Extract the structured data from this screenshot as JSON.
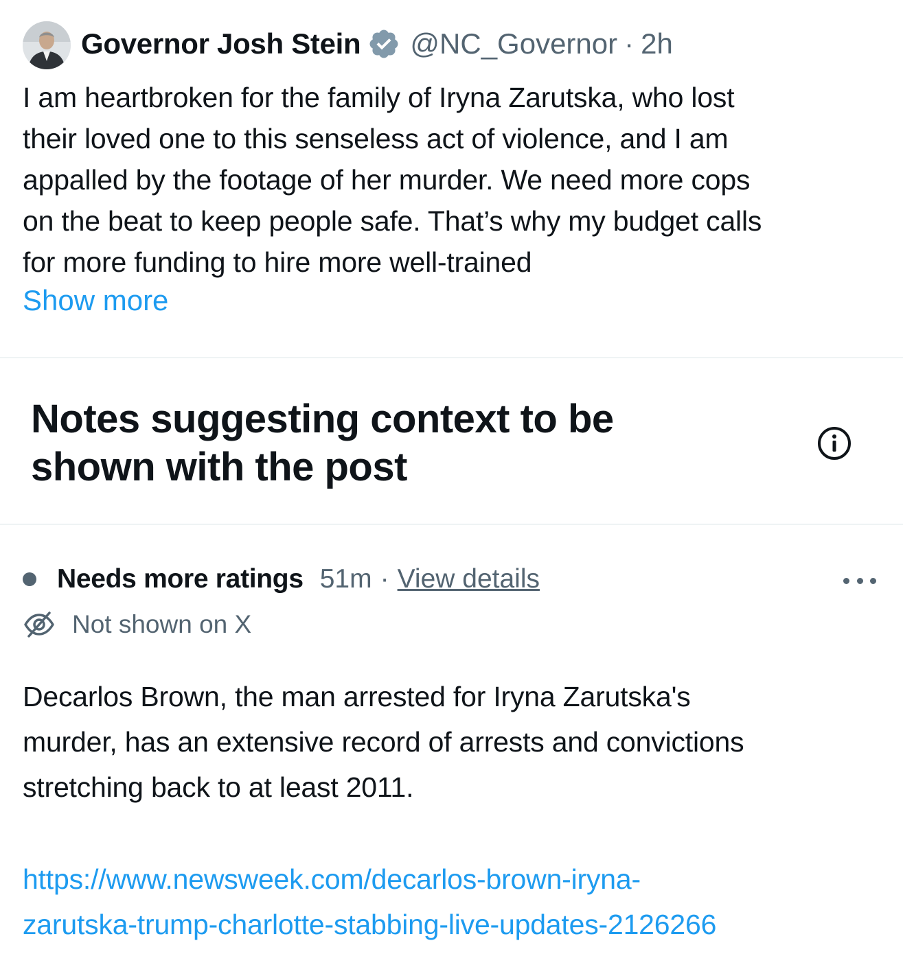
{
  "post": {
    "author_name": "Governor Josh Stein",
    "verified_icon": "verified-badge-icon",
    "handle": "@NC_Governor",
    "separator": "·",
    "time": "2h",
    "text_lines": [
      "I am heartbroken for the family of Iryna Zarutska, who lost",
      "their loved one to this senseless act of violence, and I am",
      "appalled by the footage of her murder. We need more cops",
      "on the beat to keep people safe. That’s why my budget calls",
      "for more funding to hire more well-trained"
    ],
    "show_more": "Show more"
  },
  "notes_section": {
    "title_lines": [
      "Notes suggesting context to be",
      "shown with the post"
    ],
    "info_icon": "info-icon"
  },
  "note": {
    "status": "Needs more ratings",
    "time": "51m",
    "separator": "·",
    "view_details": "View details",
    "more_icon": "more-options-icon",
    "visibility_icon": "eye-off-icon",
    "visibility_text": "Not shown on X",
    "body_lines": [
      "Decarlos Brown, the man arrested for Iryna Zarutska's",
      "murder, has an extensive record of arrests and convictions",
      "stretching back to at least 2011."
    ],
    "link_lines": [
      "https://www.newsweek.com/decarlos-brown-iryna-",
      "zarutska-trump-charlotte-stabbing-live-updates-2126266"
    ]
  },
  "colors": {
    "text_primary": "#0f1419",
    "text_secondary": "#536471",
    "link": "#1d9bf0",
    "divider": "#eff3f4"
  }
}
